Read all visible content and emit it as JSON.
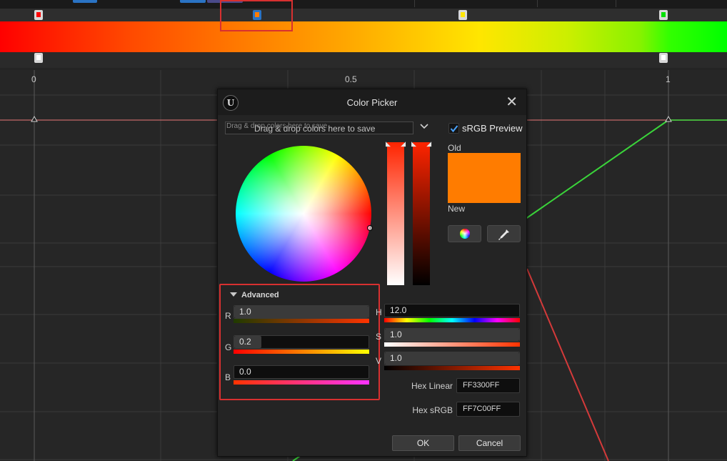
{
  "gradient": {
    "stops_top": [
      "red",
      "orange",
      "yellow",
      "green"
    ],
    "colors": {
      "red": "#ff0000",
      "orange": "#ff7c00",
      "yellow": "#ffe600",
      "green": "#00ff00"
    }
  },
  "curve_axis": {
    "ticks": [
      "0",
      "0.5",
      "1"
    ]
  },
  "dialog": {
    "title": "Color Picker",
    "close": "✕",
    "swatch_drop_ghost": "Drag & drop colors here to save",
    "swatch_drop_text": "Drag & drop colors here to save",
    "srgb_preview_label": "sRGB Preview",
    "srgb_preview_checked": true,
    "old_label": "Old",
    "new_label": "New",
    "current_color": "#ff7c00",
    "advanced_label": "Advanced",
    "channels": {
      "r_label": "R",
      "r_value": "1.0",
      "g_label": "G",
      "g_value": "0.2",
      "b_label": "B",
      "b_value": "0.0",
      "h_label": "H",
      "h_value": "12.0",
      "s_label": "S",
      "s_value": "1.0",
      "v_label": "V",
      "v_value": "1.0"
    },
    "hex_linear_label": "Hex Linear",
    "hex_linear_value": "FF3300FF",
    "hex_srgb_label": "Hex sRGB",
    "hex_srgb_value": "FF7C00FF",
    "ok_label": "OK",
    "cancel_label": "Cancel"
  }
}
